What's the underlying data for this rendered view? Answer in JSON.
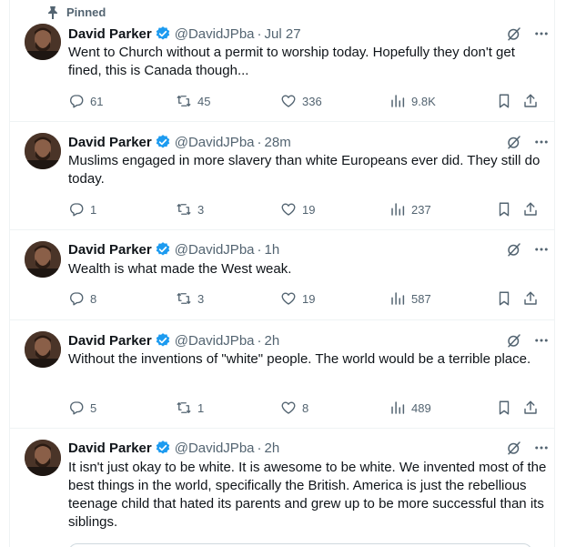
{
  "pinned_label": "Pinned",
  "author": {
    "name": "David Parker",
    "handle": "@DavidJPba"
  },
  "tweets": [
    {
      "time": "Jul 27",
      "text": "Went to Church without a permit to worship today. Hopefully they don't get fined, this is Canada though...",
      "replies": "61",
      "reposts": "45",
      "likes": "336",
      "views": "9.8K"
    },
    {
      "time": "28m",
      "text": "Muslims engaged in more slavery than white Europeans ever did. They still do today.",
      "replies": "1",
      "reposts": "3",
      "likes": "19",
      "views": "237"
    },
    {
      "time": "1h",
      "text": "Wealth is what made the West weak.",
      "replies": "8",
      "reposts": "3",
      "likes": "19",
      "views": "587"
    },
    {
      "time": "2h",
      "text": "Without the inventions of \"white\" people. The world would be a terrible place.",
      "replies": "5",
      "reposts": "1",
      "likes": "8",
      "views": "489"
    },
    {
      "time": "2h",
      "text": "It isn't just okay to be white. It is awesome to be white. We invented most of the best things in the world, specifically the British. America is just the rebellious teenage child that hated its parents and grew up to be more successful than its siblings."
    }
  ],
  "colors": {
    "verified": "#1d9bf0",
    "muted": "#536471",
    "text": "#0f1419",
    "border": "#eff3f4"
  },
  "icons": [
    "pin-icon",
    "verified-badge-icon",
    "grok-icon",
    "more-icon",
    "reply-icon",
    "repost-icon",
    "like-icon",
    "views-icon",
    "bookmark-icon",
    "share-icon"
  ]
}
